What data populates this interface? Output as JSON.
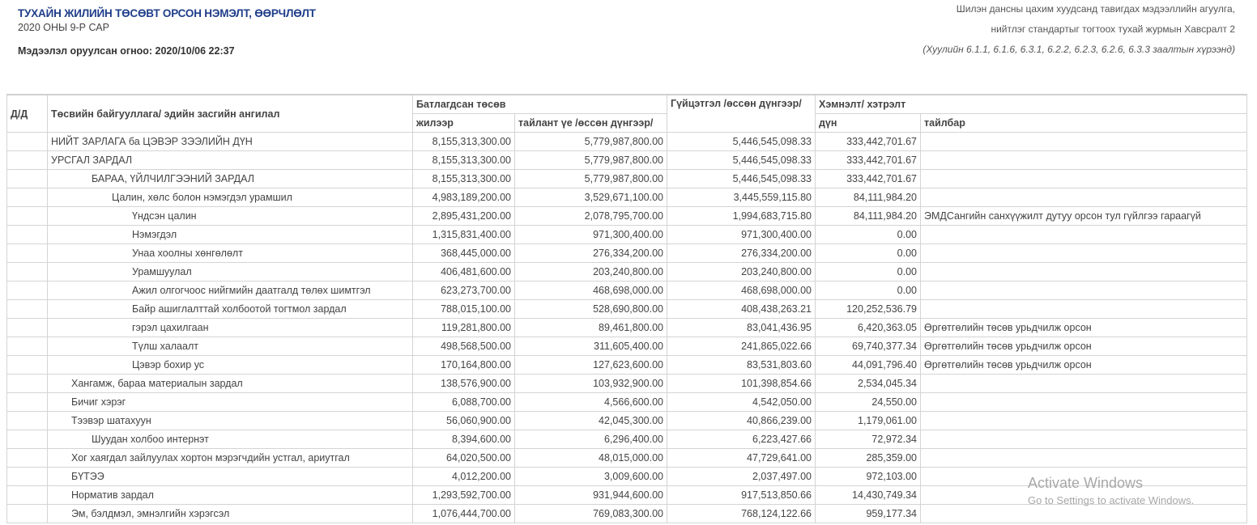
{
  "header": {
    "title": "ТУХАЙН ЖИЛИЙН ТӨСӨВТ ОРСОН НЭМЭЛТ, ӨӨРЧЛӨЛТ",
    "period": "2020 ОНЫ 9-Р САР",
    "entered": "Мэдээлэл оруулсан огноо: 2020/10/06 22:37",
    "right_line1": "Шилэн дансны цахим хуудсанд тавигдах мэдээллийн агуулга,",
    "right_line2": "нийтлэг стандартыг тогтоох тухай журмын Хавсралт 2",
    "right_line3": "(Хуулийн 6.1.1, 6.1.6, 6.3.1, 6.2.2, 6.2.3, 6.2.6, 6.3.3 заалтын хүрээнд)"
  },
  "columns": {
    "num": "Д/Д",
    "org": "Төсвийн байгууллага/ эдийн засгийн ангилал",
    "approved": "Батлагдсан төсөв",
    "yearly": "жилээр",
    "period": "тайлант үе /өссөн дүнгээр/",
    "actual": "Гүйцэтгэл /өссөн дүнгээр/",
    "change": "Хэмнэлт/ хэтрэлт",
    "amount": "дүн",
    "note": "тайлбар"
  },
  "rows": [
    {
      "name": "НИЙТ ЗАРЛАГА ба ЦЭВЭР ЗЭЭЛИЙН ДҮН",
      "level": 0,
      "bold": false,
      "yearly": "8,155,313,300.00",
      "period": "5,779,987,800.00",
      "actual": "5,446,545,098.33",
      "amount": "333,442,701.67",
      "note": ""
    },
    {
      "name": "УРСГАЛ ЗАРДАЛ",
      "level": 0,
      "bold": true,
      "yearly": "8,155,313,300.00",
      "period": "5,779,987,800.00",
      "actual": "5,446,545,098.33",
      "amount": "333,442,701.67",
      "note": ""
    },
    {
      "name": "БАРАА, ҮЙЛЧИЛГЭЭНИЙ ЗАРДАЛ",
      "level": 2,
      "bold": false,
      "yearly": "8,155,313,300.00",
      "period": "5,779,987,800.00",
      "actual": "5,446,545,098.33",
      "amount": "333,442,701.67",
      "note": ""
    },
    {
      "name": "Цалин, хөлс болон нэмэгдэл урамшил",
      "level": 3,
      "bold": false,
      "yearly": "4,983,189,200.00",
      "period": "3,529,671,100.00",
      "actual": "3,445,559,115.80",
      "amount": "84,111,984.20",
      "note": ""
    },
    {
      "name": "Үндсэн цалин",
      "level": 4,
      "bold": false,
      "yearly": "2,895,431,200.00",
      "period": "2,078,795,700.00",
      "actual": "1,994,683,715.80",
      "amount": "84,111,984.20",
      "note": "ЭМДСангийн санхүүжилт дутуу орсон тул гүйлгээ гараагүй"
    },
    {
      "name": "Нэмэгдэл",
      "level": 4,
      "bold": false,
      "yearly": "1,315,831,400.00",
      "period": "971,300,400.00",
      "actual": "971,300,400.00",
      "amount": "0.00",
      "note": ""
    },
    {
      "name": "Унаа хоолны хөнгөлөлт",
      "level": 4,
      "bold": false,
      "yearly": "368,445,000.00",
      "period": "276,334,200.00",
      "actual": "276,334,200.00",
      "amount": "0.00",
      "note": ""
    },
    {
      "name": "Урамшуулал",
      "level": 4,
      "bold": false,
      "yearly": "406,481,600.00",
      "period": "203,240,800.00",
      "actual": "203,240,800.00",
      "amount": "0.00",
      "note": ""
    },
    {
      "name": "Ажил олгогчоос нийгмийн даатгалд төлөх шимтгэл",
      "level": 4,
      "bold": false,
      "yearly": "623,273,700.00",
      "period": "468,698,000.00",
      "actual": "468,698,000.00",
      "amount": "0.00",
      "note": ""
    },
    {
      "name": "Байр ашиглалттай холбоотой тогтмол зардал",
      "level": 4,
      "bold": false,
      "yearly": "788,015,100.00",
      "period": "528,690,800.00",
      "actual": "408,438,263.21",
      "amount": "120,252,536.79",
      "note": ""
    },
    {
      "name": "гэрэл цахилгаан",
      "level": 4,
      "bold": false,
      "yearly": "119,281,800.00",
      "period": "89,461,800.00",
      "actual": "83,041,436.95",
      "amount": "6,420,363.05",
      "note": "Өргөтгөлийн төсөв урьдчилж орсон"
    },
    {
      "name": "Түлш халаалт",
      "level": 4,
      "bold": false,
      "yearly": "498,568,500.00",
      "period": "311,605,400.00",
      "actual": "241,865,022.66",
      "amount": "69,740,377.34",
      "note": "Өргөтгөлийн төсөв урьдчилж орсон"
    },
    {
      "name": "Цэвэр бохир ус",
      "level": 4,
      "bold": false,
      "yearly": "170,164,800.00",
      "period": "127,623,600.00",
      "actual": "83,531,803.60",
      "amount": "44,091,796.40",
      "note": "Өргөтгөлийн төсөв урьдчилж орсон"
    },
    {
      "name": "Хангамж, бараа материалын зардал",
      "level": 1,
      "bold": false,
      "yearly": "138,576,900.00",
      "period": "103,932,900.00",
      "actual": "101,398,854.66",
      "amount": "2,534,045.34",
      "note": ""
    },
    {
      "name": "Бичиг хэрэг",
      "level": 1,
      "bold": false,
      "yearly": "6,088,700.00",
      "period": "4,566,600.00",
      "actual": "4,542,050.00",
      "amount": "24,550.00",
      "note": ""
    },
    {
      "name": "Тээвэр шатахуун",
      "level": 1,
      "bold": false,
      "yearly": "56,060,900.00",
      "period": "42,045,300.00",
      "actual": "40,866,239.00",
      "amount": "1,179,061.00",
      "note": ""
    },
    {
      "name": "Шуудан холбоо интернэт",
      "level": 2,
      "bold": false,
      "yearly": "8,394,600.00",
      "period": "6,296,400.00",
      "actual": "6,223,427.66",
      "amount": "72,972.34",
      "note": ""
    },
    {
      "name": "Хог хаягдал зайлуулах хортон мэрэгчдийн устгал, ариутгал",
      "level": 1,
      "bold": false,
      "yearly": "64,020,500.00",
      "period": "48,015,000.00",
      "actual": "47,729,641.00",
      "amount": "285,359.00",
      "note": ""
    },
    {
      "name": "БҮТЭЭ",
      "level": 1,
      "bold": false,
      "yearly": "4,012,200.00",
      "period": "3,009,600.00",
      "actual": "2,037,497.00",
      "amount": "972,103.00",
      "note": ""
    },
    {
      "name": "Норматив зардал",
      "level": 1,
      "bold": false,
      "yearly": "1,293,592,700.00",
      "period": "931,944,600.00",
      "actual": "917,513,850.66",
      "amount": "14,430,749.34",
      "note": ""
    },
    {
      "name": "Эм, бэлдмэл, эмнэлгийн хэрэгсэл",
      "level": 1,
      "bold": false,
      "yearly": "1,076,444,700.00",
      "period": "769,083,300.00",
      "actual": "768,124,122.66",
      "amount": "959,177.34",
      "note": ""
    }
  ],
  "watermark": {
    "line1": "Activate Windows",
    "line2": "Go to Settings to activate Windows."
  }
}
